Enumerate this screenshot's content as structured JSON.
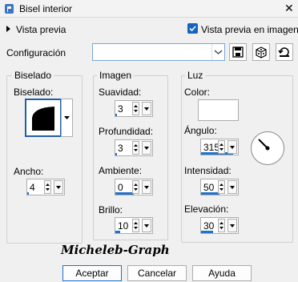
{
  "window": {
    "title": "Bisel interior",
    "close_glyph": "✕",
    "icon": "app-icon"
  },
  "preview": {
    "toggle_label": "Vista previa",
    "live_label": "Vista previa en imagen",
    "live_checked": true
  },
  "config": {
    "label": "Configuración",
    "value": "",
    "icons": [
      "save-icon",
      "dice-icon",
      "reset-icon"
    ]
  },
  "beveled": {
    "group_title": "Biselado",
    "bevel_label": "Biselado:",
    "width_label": "Ancho:",
    "width_value": "4",
    "width_fill": 0.05
  },
  "image": {
    "group_title": "Imagen",
    "smoothness_label": "Suavidad:",
    "smoothness_value": "3",
    "smoothness_fill": 0.04,
    "depth_label": "Profundidad:",
    "depth_value": "3",
    "depth_fill": 0.04,
    "ambient_label": "Ambiente:",
    "ambient_value": "0",
    "ambient_fill": 0.5,
    "shine_label": "Brillo:",
    "shine_value": "10",
    "shine_fill": 0.12
  },
  "light": {
    "group_title": "Luz",
    "color_label": "Color:",
    "color": "#ffffff",
    "angle_label": "Ángulo:",
    "angle_value": "315",
    "angle_fill": 0.88,
    "intensity_label": "Intensidad:",
    "intensity_value": "50",
    "intensity_fill": 0.5,
    "elevation_label": "Elevación:",
    "elevation_value": "30",
    "elevation_fill": 0.33
  },
  "watermark": "Micheleb-Graph",
  "buttons": {
    "ok": "Aceptar",
    "cancel": "Cancelar",
    "help": "Ayuda"
  },
  "colors": {
    "accent": "#1f73c8",
    "checkbox": "#1565c0"
  }
}
